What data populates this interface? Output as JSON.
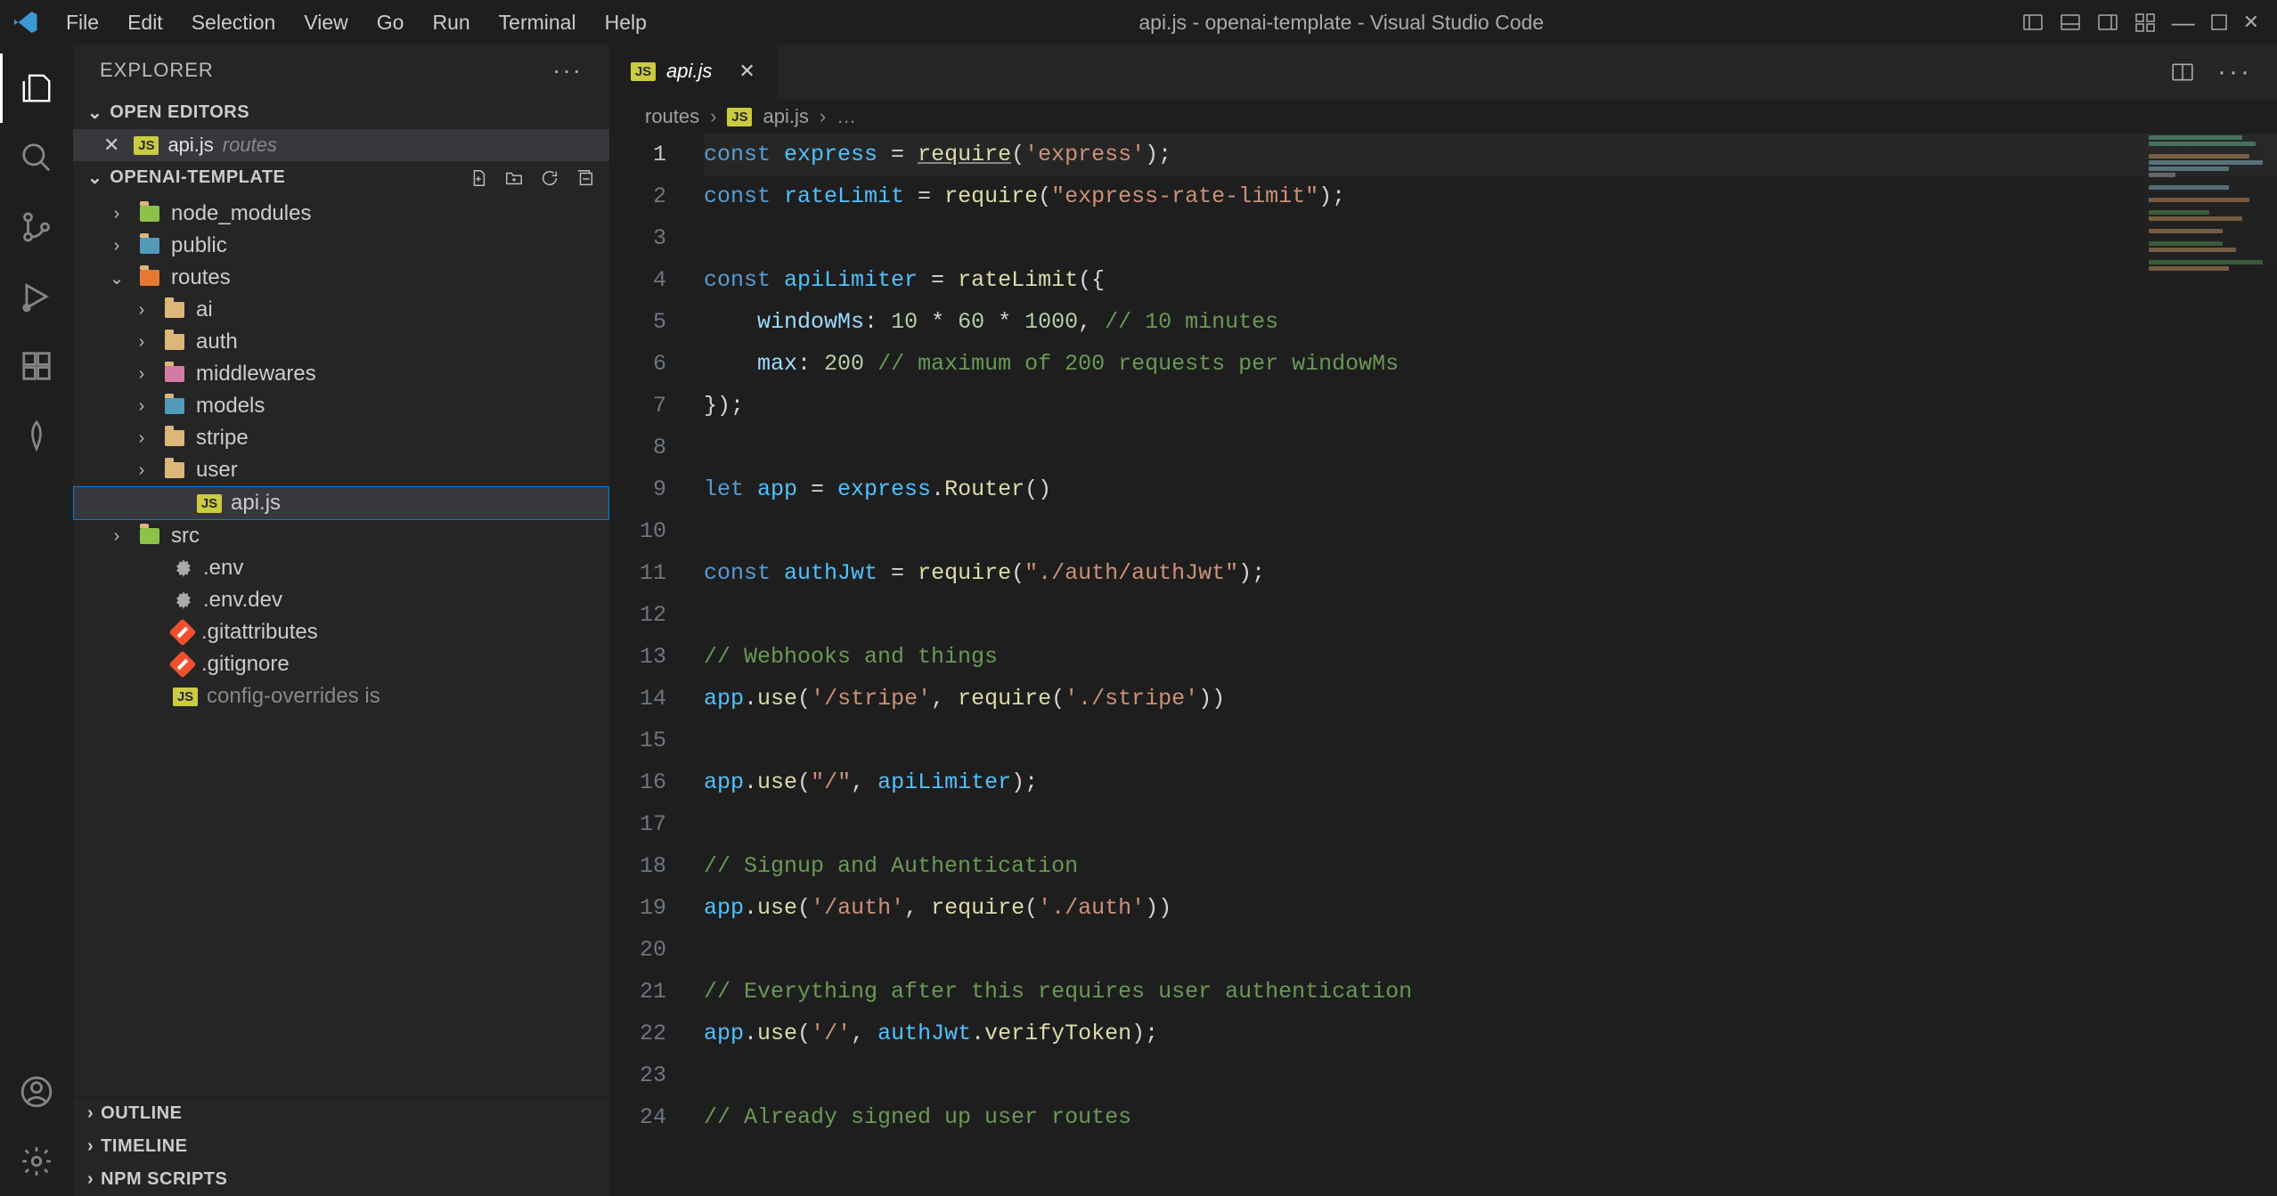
{
  "menubar": {
    "items": [
      "File",
      "Edit",
      "Selection",
      "View",
      "Go",
      "Run",
      "Terminal",
      "Help"
    ],
    "title": "api.js - openai-template - Visual Studio Code"
  },
  "sidebar": {
    "title": "EXPLORER",
    "sections": {
      "open_editors": {
        "label": "OPEN EDITORS",
        "items": [
          {
            "filename": "api.js",
            "dir": "routes"
          }
        ]
      },
      "project": {
        "label": "OPENAI-TEMPLATE",
        "tree": [
          {
            "name": "node_modules",
            "type": "folder-special",
            "color": "#8dc149",
            "expanded": false,
            "depth": 1
          },
          {
            "name": "public",
            "type": "folder-special",
            "color": "#519aba",
            "expanded": false,
            "depth": 1
          },
          {
            "name": "routes",
            "type": "folder-special",
            "color": "#e37933",
            "expanded": true,
            "depth": 1
          },
          {
            "name": "ai",
            "type": "folder",
            "expanded": false,
            "depth": 2
          },
          {
            "name": "auth",
            "type": "folder",
            "expanded": false,
            "depth": 2
          },
          {
            "name": "middlewares",
            "type": "folder-pink",
            "expanded": false,
            "depth": 2
          },
          {
            "name": "models",
            "type": "folder-blue",
            "expanded": false,
            "depth": 2
          },
          {
            "name": "stripe",
            "type": "folder",
            "expanded": false,
            "depth": 2
          },
          {
            "name": "user",
            "type": "folder",
            "expanded": false,
            "depth": 2
          },
          {
            "name": "api.js",
            "type": "js",
            "depth": 2,
            "selected": true
          },
          {
            "name": "src",
            "type": "folder-green",
            "expanded": false,
            "depth": 1
          },
          {
            "name": ".env",
            "type": "gear",
            "depth": 1
          },
          {
            "name": ".env.dev",
            "type": "gear",
            "depth": 1
          },
          {
            "name": ".gitattributes",
            "type": "git",
            "depth": 1
          },
          {
            "name": ".gitignore",
            "type": "git",
            "depth": 1
          },
          {
            "name": "config-overrides is",
            "type": "js-trunc",
            "depth": 1,
            "truncated": true
          }
        ]
      },
      "outline": {
        "label": "OUTLINE"
      },
      "timeline": {
        "label": "TIMELINE"
      },
      "npm_scripts": {
        "label": "NPM SCRIPTS"
      }
    }
  },
  "tab": {
    "filename": "api.js"
  },
  "breadcrumbs": {
    "parts": [
      "routes",
      "api.js",
      "…"
    ]
  },
  "code": {
    "lines": [
      [
        {
          "t": "const ",
          "c": "tk-kw"
        },
        {
          "t": "express",
          "c": "tk-var"
        },
        {
          "t": " = "
        },
        {
          "t": "require",
          "c": "tk-fn tk-autol"
        },
        {
          "t": "("
        },
        {
          "t": "'express'",
          "c": "tk-str"
        },
        {
          "t": ");"
        }
      ],
      [
        {
          "t": "const ",
          "c": "tk-kw"
        },
        {
          "t": "rateLimit",
          "c": "tk-var"
        },
        {
          "t": " = "
        },
        {
          "t": "require",
          "c": "tk-fn"
        },
        {
          "t": "("
        },
        {
          "t": "\"express-rate-limit\"",
          "c": "tk-str"
        },
        {
          "t": ");"
        }
      ],
      [
        {
          "t": ""
        }
      ],
      [
        {
          "t": "const ",
          "c": "tk-kw"
        },
        {
          "t": "apiLimiter",
          "c": "tk-var"
        },
        {
          "t": " = "
        },
        {
          "t": "rateLimit",
          "c": "tk-fn"
        },
        {
          "t": "({"
        }
      ],
      [
        {
          "t": "    "
        },
        {
          "t": "windowMs",
          "c": "tk-prop"
        },
        {
          "t": ": "
        },
        {
          "t": "10",
          "c": "tk-num"
        },
        {
          "t": " * "
        },
        {
          "t": "60",
          "c": "tk-num"
        },
        {
          "t": " * "
        },
        {
          "t": "1000",
          "c": "tk-num"
        },
        {
          "t": ", "
        },
        {
          "t": "// 10 minutes",
          "c": "tk-com"
        }
      ],
      [
        {
          "t": "    "
        },
        {
          "t": "max",
          "c": "tk-prop"
        },
        {
          "t": ": "
        },
        {
          "t": "200",
          "c": "tk-num"
        },
        {
          "t": " "
        },
        {
          "t": "// maximum of 200 requests per windowMs",
          "c": "tk-com"
        }
      ],
      [
        {
          "t": "});"
        }
      ],
      [
        {
          "t": ""
        }
      ],
      [
        {
          "t": "let ",
          "c": "tk-kw"
        },
        {
          "t": "app",
          "c": "tk-var"
        },
        {
          "t": " = "
        },
        {
          "t": "express",
          "c": "tk-var"
        },
        {
          "t": "."
        },
        {
          "t": "Router",
          "c": "tk-fn"
        },
        {
          "t": "()"
        }
      ],
      [
        {
          "t": ""
        }
      ],
      [
        {
          "t": "const ",
          "c": "tk-kw"
        },
        {
          "t": "authJwt",
          "c": "tk-var"
        },
        {
          "t": " = "
        },
        {
          "t": "require",
          "c": "tk-fn"
        },
        {
          "t": "("
        },
        {
          "t": "\"./auth/authJwt\"",
          "c": "tk-str"
        },
        {
          "t": ");"
        }
      ],
      [
        {
          "t": ""
        }
      ],
      [
        {
          "t": "// Webhooks and things",
          "c": "tk-com"
        }
      ],
      [
        {
          "t": "app",
          "c": "tk-var"
        },
        {
          "t": "."
        },
        {
          "t": "use",
          "c": "tk-fn"
        },
        {
          "t": "("
        },
        {
          "t": "'/stripe'",
          "c": "tk-str"
        },
        {
          "t": ", "
        },
        {
          "t": "require",
          "c": "tk-fn"
        },
        {
          "t": "("
        },
        {
          "t": "'./stripe'",
          "c": "tk-str"
        },
        {
          "t": "))"
        }
      ],
      [
        {
          "t": ""
        }
      ],
      [
        {
          "t": "app",
          "c": "tk-var"
        },
        {
          "t": "."
        },
        {
          "t": "use",
          "c": "tk-fn"
        },
        {
          "t": "("
        },
        {
          "t": "\"/\"",
          "c": "tk-str"
        },
        {
          "t": ", "
        },
        {
          "t": "apiLimiter",
          "c": "tk-var"
        },
        {
          "t": ");"
        }
      ],
      [
        {
          "t": ""
        }
      ],
      [
        {
          "t": "// Signup and Authentication",
          "c": "tk-com"
        }
      ],
      [
        {
          "t": "app",
          "c": "tk-var"
        },
        {
          "t": "."
        },
        {
          "t": "use",
          "c": "tk-fn"
        },
        {
          "t": "("
        },
        {
          "t": "'/auth'",
          "c": "tk-str"
        },
        {
          "t": ", "
        },
        {
          "t": "require",
          "c": "tk-fn"
        },
        {
          "t": "("
        },
        {
          "t": "'./auth'",
          "c": "tk-str"
        },
        {
          "t": "))"
        }
      ],
      [
        {
          "t": ""
        }
      ],
      [
        {
          "t": "// Everything after this requires user authentication",
          "c": "tk-com"
        }
      ],
      [
        {
          "t": "app",
          "c": "tk-var"
        },
        {
          "t": "."
        },
        {
          "t": "use",
          "c": "tk-fn"
        },
        {
          "t": "("
        },
        {
          "t": "'/'",
          "c": "tk-str"
        },
        {
          "t": ", "
        },
        {
          "t": "authJwt",
          "c": "tk-var"
        },
        {
          "t": "."
        },
        {
          "t": "verifyToken",
          "c": "tk-fn"
        },
        {
          "t": ");"
        }
      ],
      [
        {
          "t": ""
        }
      ],
      [
        {
          "t": "// Already signed up user routes",
          "c": "tk-com"
        }
      ]
    ],
    "active_line": 1
  }
}
